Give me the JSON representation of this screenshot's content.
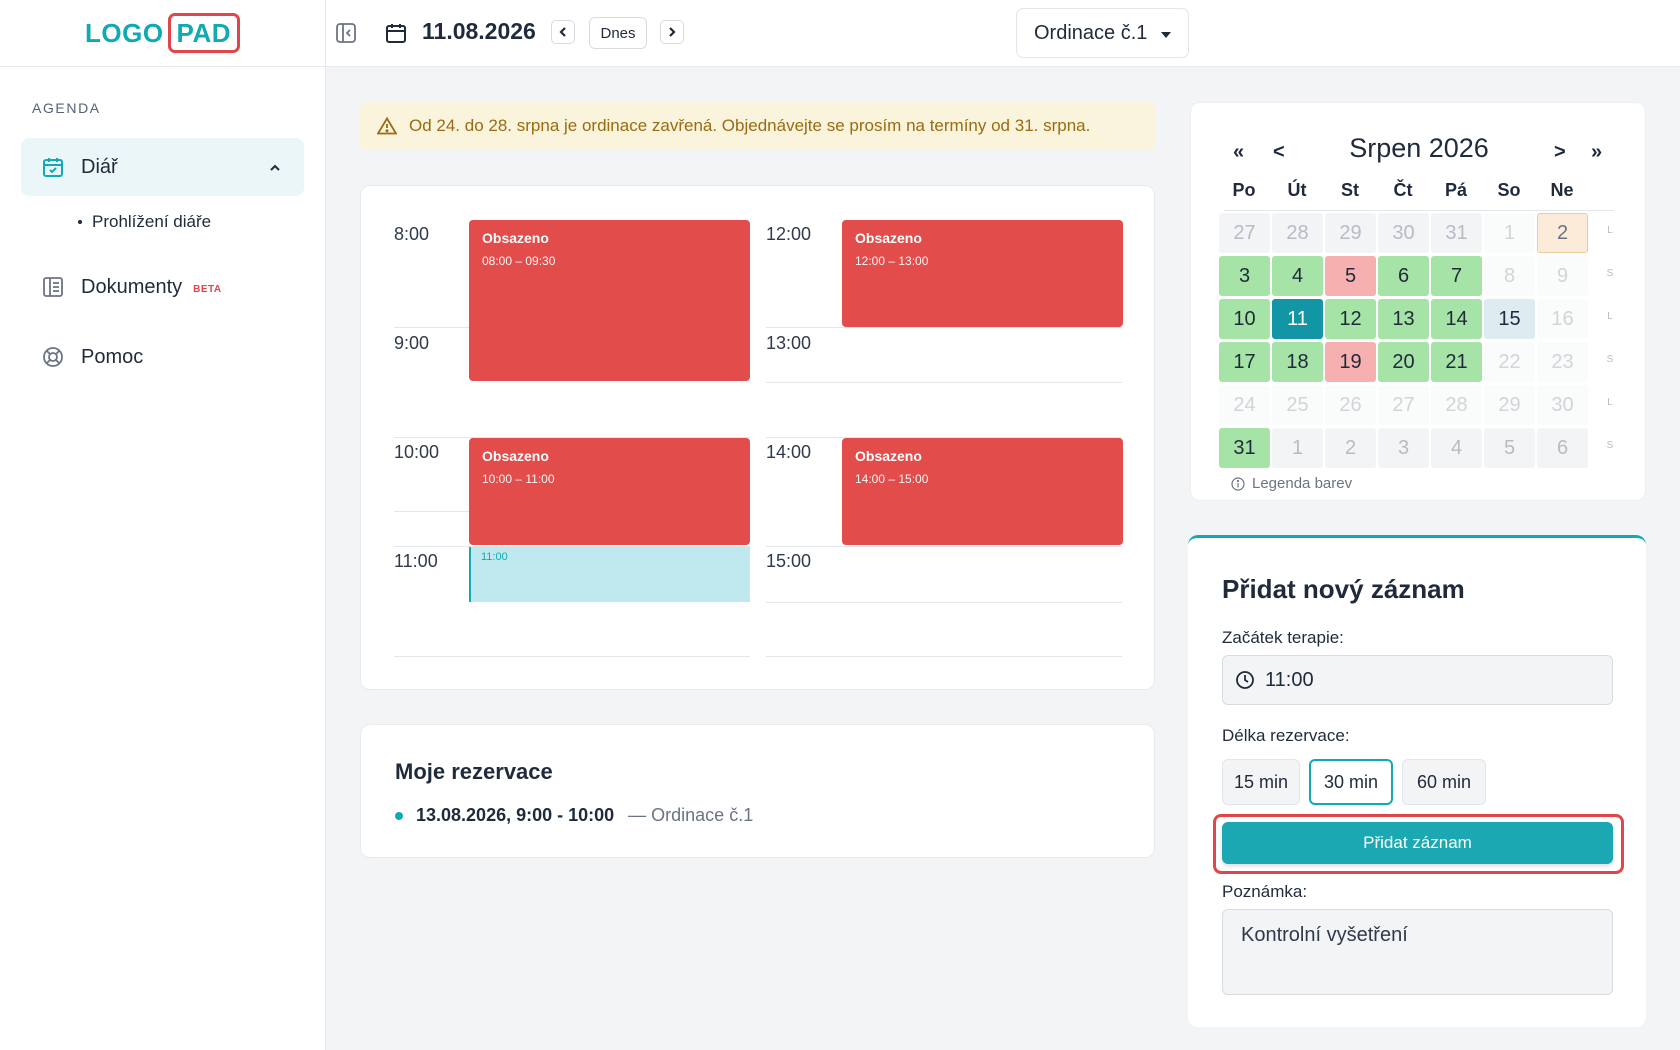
{
  "logo": {
    "part1": "LOGO",
    "part2": "PAD"
  },
  "sidebar": {
    "section_label": "AGENDA",
    "items": [
      {
        "label": "Diář",
        "icon": "calendar-check-icon",
        "active": true
      },
      {
        "label": "Dokumenty",
        "icon": "document-icon",
        "badge": "BETA"
      },
      {
        "label": "Pomoc",
        "icon": "lifebuoy-icon"
      }
    ],
    "sub_item": "Prohlížení diáře"
  },
  "topbar": {
    "date": "11.08.2026",
    "today_label": "Dnes",
    "office_select": "Ordinace č.1"
  },
  "alert": {
    "text": "Od 24. do 28. srpna je ordinace zavřená. Objednávejte se prosím na termíny od 31. srpna.",
    "color": "#9a6b12"
  },
  "schedule": {
    "hours": [
      "8:00",
      "9:00",
      "10:00",
      "11:00",
      "12:00",
      "13:00",
      "14:00",
      "15:00"
    ],
    "busy_slots": [
      {
        "title": "Obsazeno",
        "range": "08:00 – 09:30"
      },
      {
        "title": "Obsazeno",
        "range": "12:00 – 13:00"
      },
      {
        "title": "Obsazeno",
        "range": "10:00 – 11:00"
      },
      {
        "title": "Obsazeno",
        "range": "14:00 – 15:00"
      }
    ],
    "selected_slot": "11:00",
    "busy_color": "#e24c4a",
    "selected_color": "#bfe9ee"
  },
  "reservations": {
    "title": "Moje rezervace",
    "items": [
      {
        "date": "13.08.2026, 9:00 - 10:00",
        "office": "— Ordinace č.1"
      }
    ]
  },
  "calendar": {
    "month": "Srpen 2026",
    "nav": {
      "prev_year": "«",
      "prev": "<",
      "next": ">",
      "next_year": "»"
    },
    "weekdays": [
      "Po",
      "Út",
      "St",
      "Čt",
      "Pá",
      "So",
      "Ne"
    ],
    "weeks": [
      {
        "suffix": "L",
        "days": [
          {
            "d": "27",
            "s": "mute"
          },
          {
            "d": "28",
            "s": "mute"
          },
          {
            "d": "29",
            "s": "mute"
          },
          {
            "d": "30",
            "s": "mute"
          },
          {
            "d": "31",
            "s": "mute"
          },
          {
            "d": "1",
            "s": "faint"
          },
          {
            "d": "2",
            "s": "orange"
          }
        ]
      },
      {
        "suffix": "S",
        "days": [
          {
            "d": "3",
            "s": "green"
          },
          {
            "d": "4",
            "s": "green"
          },
          {
            "d": "5",
            "s": "red"
          },
          {
            "d": "6",
            "s": "green"
          },
          {
            "d": "7",
            "s": "green"
          },
          {
            "d": "8",
            "s": "faint"
          },
          {
            "d": "9",
            "s": "faint"
          }
        ]
      },
      {
        "suffix": "L",
        "days": [
          {
            "d": "10",
            "s": "green"
          },
          {
            "d": "11",
            "s": "today"
          },
          {
            "d": "12",
            "s": "green"
          },
          {
            "d": "13",
            "s": "green"
          },
          {
            "d": "14",
            "s": "green"
          },
          {
            "d": "15",
            "s": "light"
          },
          {
            "d": "16",
            "s": "faint"
          }
        ]
      },
      {
        "suffix": "S",
        "days": [
          {
            "d": "17",
            "s": "green"
          },
          {
            "d": "18",
            "s": "green"
          },
          {
            "d": "19",
            "s": "red"
          },
          {
            "d": "20",
            "s": "green"
          },
          {
            "d": "21",
            "s": "green"
          },
          {
            "d": "22",
            "s": "faint"
          },
          {
            "d": "23",
            "s": "faint"
          }
        ]
      },
      {
        "suffix": "L",
        "days": [
          {
            "d": "24",
            "s": "faint"
          },
          {
            "d": "25",
            "s": "faint"
          },
          {
            "d": "26",
            "s": "faint"
          },
          {
            "d": "27",
            "s": "faint"
          },
          {
            "d": "28",
            "s": "faint"
          },
          {
            "d": "29",
            "s": "faint"
          },
          {
            "d": "30",
            "s": "faint"
          }
        ]
      },
      {
        "suffix": "S",
        "days": [
          {
            "d": "31",
            "s": "green"
          },
          {
            "d": "1",
            "s": "mute"
          },
          {
            "d": "2",
            "s": "mute"
          },
          {
            "d": "3",
            "s": "mute"
          },
          {
            "d": "4",
            "s": "mute"
          },
          {
            "d": "5",
            "s": "mute"
          },
          {
            "d": "6",
            "s": "mute"
          }
        ]
      }
    ],
    "legend": "Legenda barev"
  },
  "form": {
    "title": "Přidat nový záznam",
    "start_label": "Začátek terapie:",
    "start_value": "11:00",
    "duration_label": "Délka rezervace:",
    "durations": [
      "15 min",
      "30 min",
      "60 min"
    ],
    "selected_duration": "30 min",
    "submit_label": "Přidat záznam",
    "note_label": "Poznámka:",
    "note_value": "Kontrolní vyšetření",
    "accent": "#11a9b4"
  }
}
